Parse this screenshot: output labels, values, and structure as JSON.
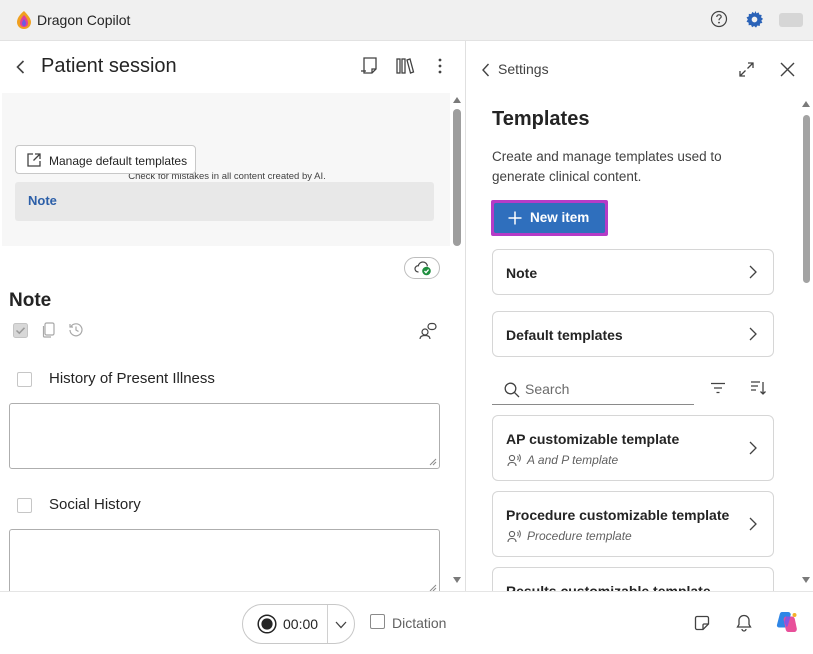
{
  "app": {
    "title": "Dragon Copilot",
    "icons": [
      "dragon-logo-icon",
      "help-icon",
      "settings-gear-icon",
      "user-avatar"
    ]
  },
  "left_panel": {
    "title": "Patient session",
    "header_icons": [
      "back-arrow-icon",
      "note-icon",
      "library-icon",
      "more-icon"
    ],
    "disclaimer": "Check for mistakes in all content created by AI.",
    "manage_button": "Manage default templates",
    "active_tab": "Note",
    "note": {
      "heading": "Note",
      "toolbar_icons": [
        "select-all-checkbox-icon",
        "copy-icon",
        "history-icon",
        "assistant-icon"
      ],
      "sections": [
        {
          "title": "History of Present Illness",
          "value": ""
        },
        {
          "title": "Social History",
          "value": ""
        }
      ]
    }
  },
  "right_panel": {
    "back_label": "Settings",
    "header_icons": [
      "expand-icon",
      "close-icon"
    ],
    "title": "Templates",
    "description": "Create and manage templates used to generate clinical content.",
    "new_item_label": "New item",
    "nav_cards": [
      {
        "label": "Note"
      },
      {
        "label": "Default templates"
      }
    ],
    "search_placeholder": "Search",
    "tools_icons": [
      "filter-icon",
      "sort-icon"
    ],
    "templates": [
      {
        "name": "AP customizable template",
        "type": "A and P template"
      },
      {
        "name": "Procedure customizable template",
        "type": "Procedure template"
      },
      {
        "name": "Results customizable template",
        "type": ""
      }
    ]
  },
  "bottom_bar": {
    "timer": "00:00",
    "dictation_label": "Dictation",
    "dictation_checked": false,
    "icons": [
      "sticky-note-icon",
      "notification-bell-icon",
      "copilot-icon"
    ]
  },
  "colors": {
    "accent_blue": "#2f6fbd",
    "highlight_magenta": "#b53bc7",
    "note_tab_text": "#2c5fa8",
    "gear_blue": "#2b63b8"
  }
}
